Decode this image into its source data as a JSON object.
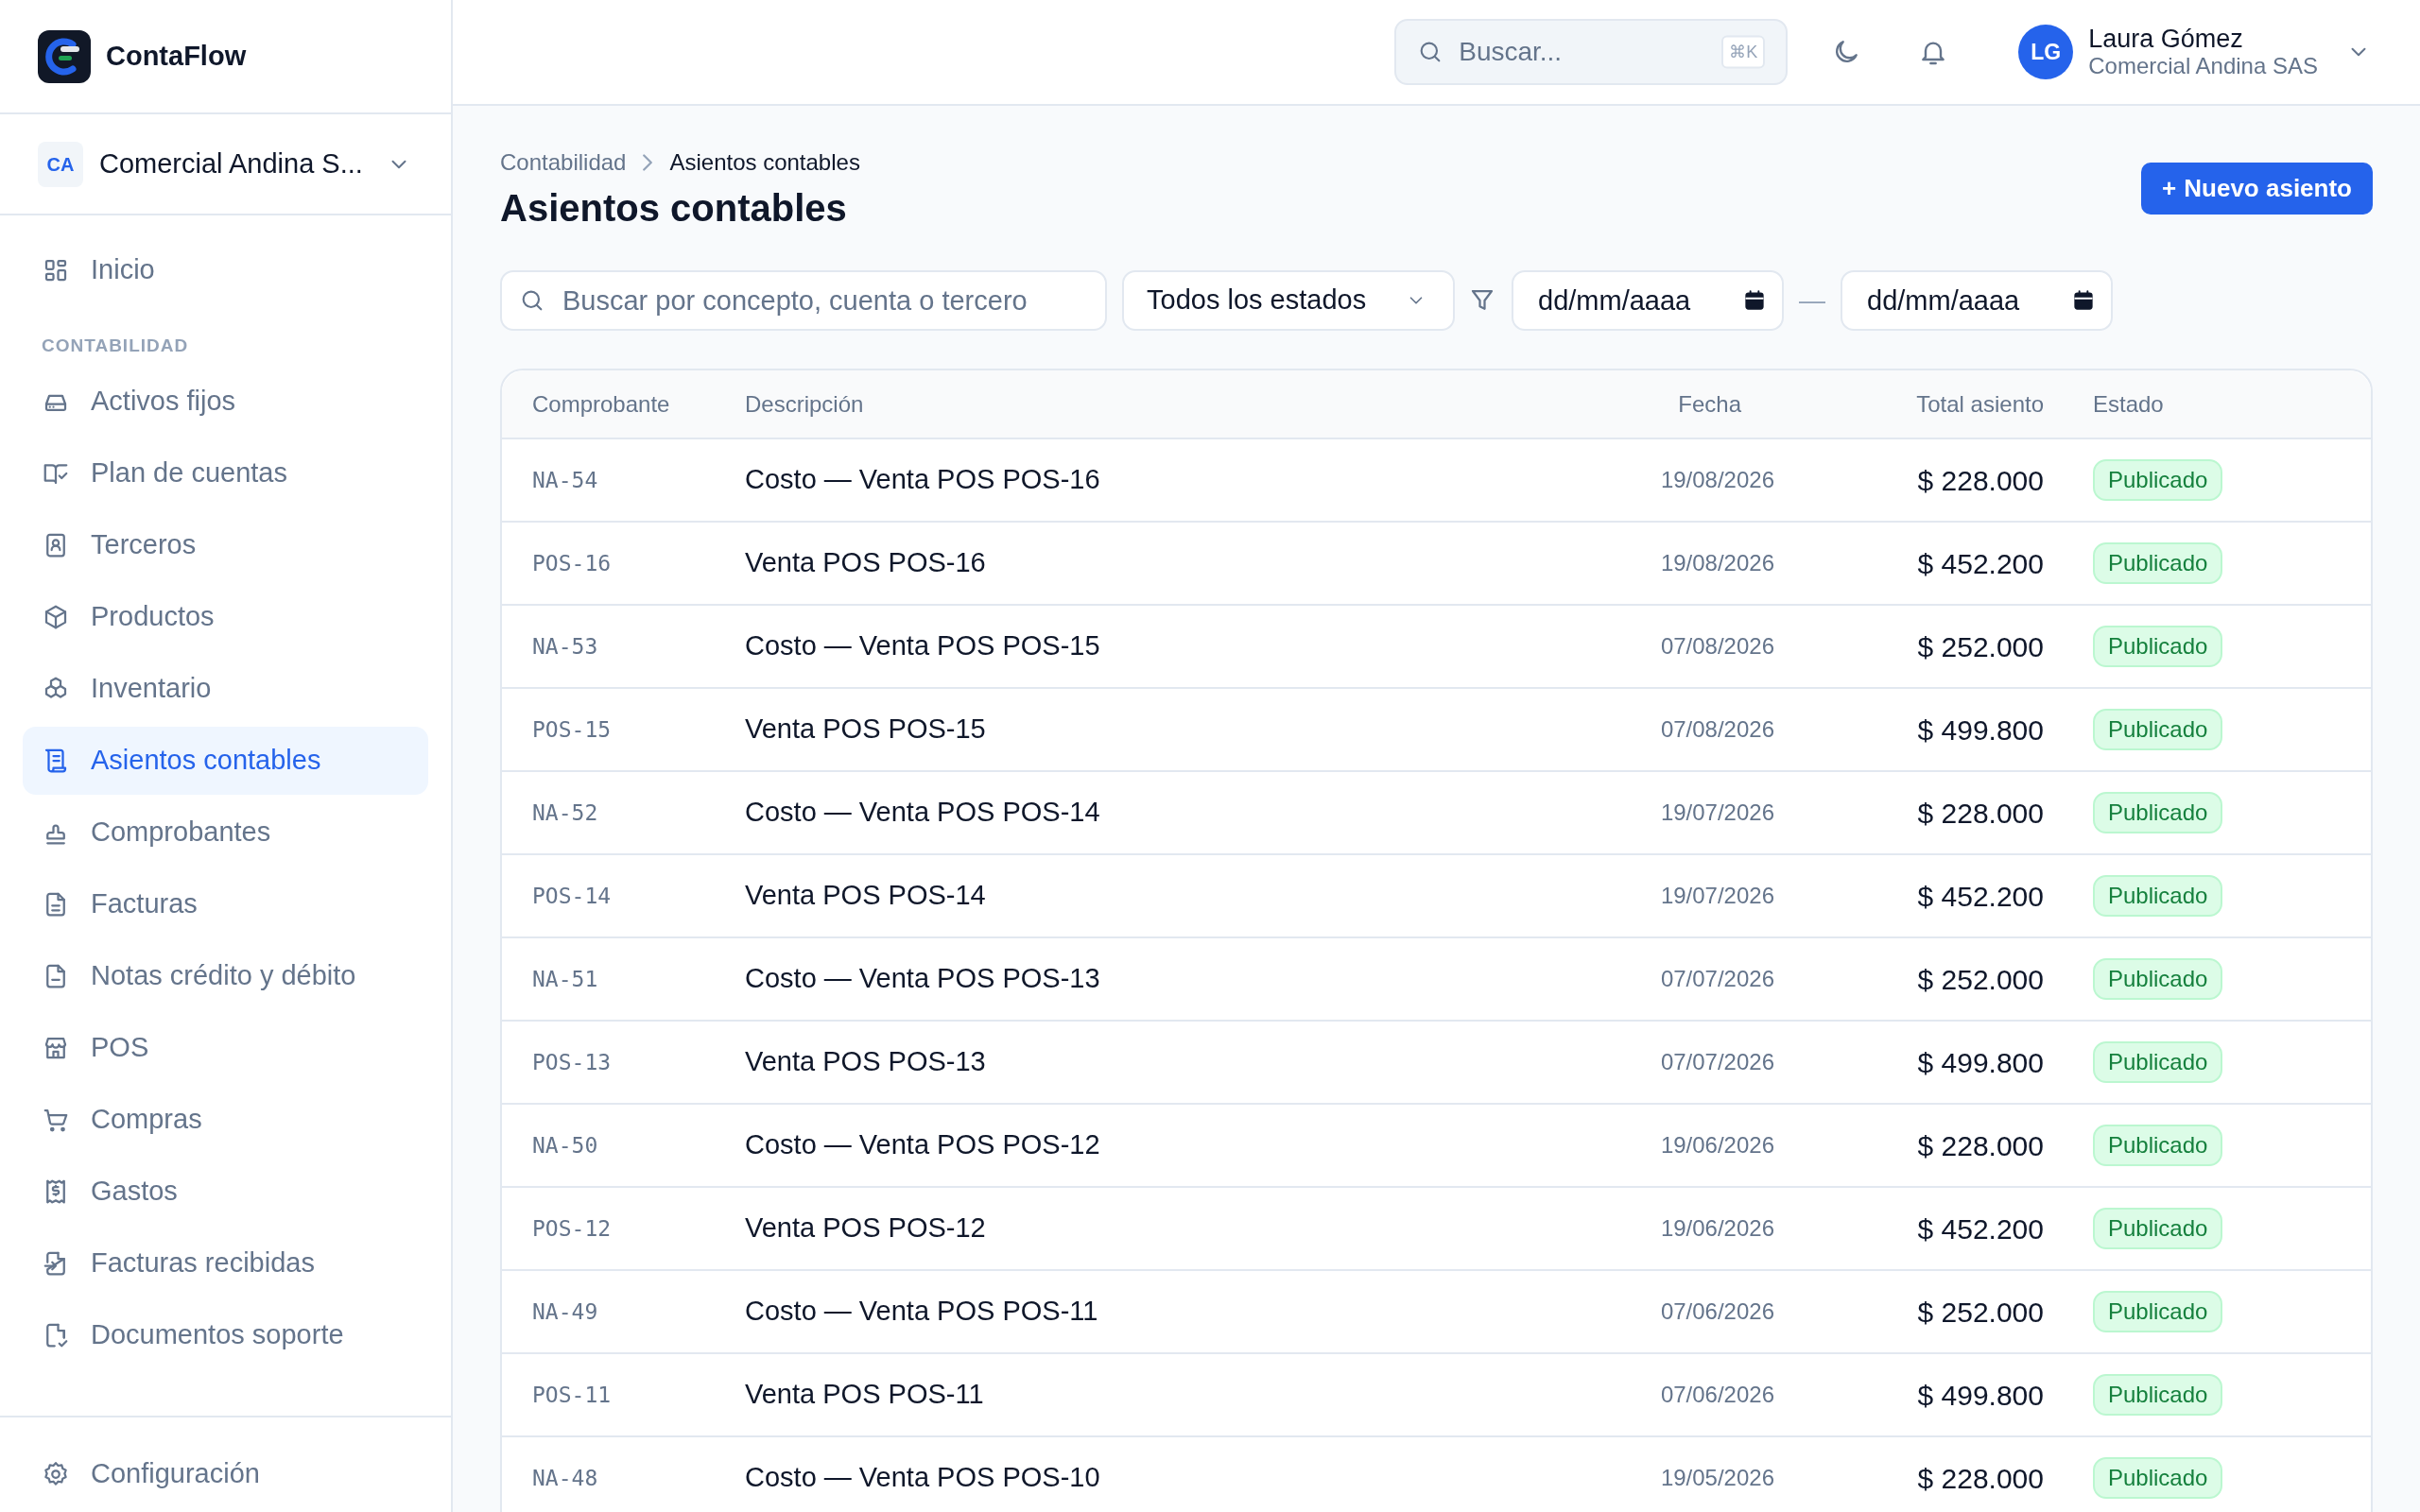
{
  "brand": {
    "name": "ContaFlow"
  },
  "company": {
    "initials": "CA",
    "name": "Comercial Andina S..."
  },
  "nav": [
    {
      "items": [
        {
          "label": "Inicio",
          "selected": false
        }
      ]
    },
    {
      "heading": "CONTABILIDAD",
      "items": [
        {
          "label": "Activos fijos",
          "selected": false
        },
        {
          "label": "Plan de cuentas",
          "selected": false
        },
        {
          "label": "Terceros",
          "selected": false
        },
        {
          "label": "Productos",
          "selected": false
        },
        {
          "label": "Inventario",
          "selected": false
        },
        {
          "label": "Asientos contables",
          "selected": true
        },
        {
          "label": "Comprobantes",
          "selected": false
        },
        {
          "label": "Facturas",
          "selected": false
        },
        {
          "label": "Notas crédito y débito",
          "selected": false
        },
        {
          "label": "POS",
          "selected": false
        },
        {
          "label": "Compras",
          "selected": false
        },
        {
          "label": "Gastos",
          "selected": false
        },
        {
          "label": "Facturas recibidas",
          "selected": false
        },
        {
          "label": "Documentos soporte",
          "selected": false
        }
      ]
    }
  ],
  "nav_footer": {
    "label": "Configuración",
    "selected": false
  },
  "topbar": {
    "search": {
      "placeholder": "Buscar...",
      "shortcut": "⌘K"
    },
    "user": {
      "initials": "LG",
      "name": "Laura Gómez",
      "company": "Comercial Andina SAS"
    }
  },
  "breadcrumb": [
    {
      "label": "Contabilidad",
      "current": false
    },
    {
      "label": "Asientos contables",
      "current": true
    }
  ],
  "title": "Asientos contables",
  "new_button": {
    "icon": "+",
    "label": "Nuevo asiento"
  },
  "filters": {
    "search": {
      "placeholder": "Buscar por concepto, cuenta o tercero"
    },
    "status": "Todos los estados",
    "date_from": {
      "placeholder": "dd/mm/aaaa"
    },
    "separator": "—",
    "date_to": {
      "placeholder": "dd/mm/aaaa"
    }
  },
  "table": {
    "columns": [
      "Comprobante",
      "Descripción",
      "Fecha",
      "Total asiento",
      "Estado"
    ],
    "rows": [
      {
        "voucher": "NA-54",
        "description": "Costo — Venta POS POS-16",
        "date": "19/08/2026",
        "total": "$ 228.000",
        "status": "Publicado"
      },
      {
        "voucher": "POS-16",
        "description": "Venta POS POS-16",
        "date": "19/08/2026",
        "total": "$ 452.200",
        "status": "Publicado"
      },
      {
        "voucher": "NA-53",
        "description": "Costo — Venta POS POS-15",
        "date": "07/08/2026",
        "total": "$ 252.000",
        "status": "Publicado"
      },
      {
        "voucher": "POS-15",
        "description": "Venta POS POS-15",
        "date": "07/08/2026",
        "total": "$ 499.800",
        "status": "Publicado"
      },
      {
        "voucher": "NA-52",
        "description": "Costo — Venta POS POS-14",
        "date": "19/07/2026",
        "total": "$ 228.000",
        "status": "Publicado"
      },
      {
        "voucher": "POS-14",
        "description": "Venta POS POS-14",
        "date": "19/07/2026",
        "total": "$ 452.200",
        "status": "Publicado"
      },
      {
        "voucher": "NA-51",
        "description": "Costo — Venta POS POS-13",
        "date": "07/07/2026",
        "total": "$ 252.000",
        "status": "Publicado"
      },
      {
        "voucher": "POS-13",
        "description": "Venta POS POS-13",
        "date": "07/07/2026",
        "total": "$ 499.800",
        "status": "Publicado"
      },
      {
        "voucher": "NA-50",
        "description": "Costo — Venta POS POS-12",
        "date": "19/06/2026",
        "total": "$ 228.000",
        "status": "Publicado"
      },
      {
        "voucher": "POS-12",
        "description": "Venta POS POS-12",
        "date": "19/06/2026",
        "total": "$ 452.200",
        "status": "Publicado"
      },
      {
        "voucher": "NA-49",
        "description": "Costo — Venta POS POS-11",
        "date": "07/06/2026",
        "total": "$ 252.000",
        "status": "Publicado"
      },
      {
        "voucher": "POS-11",
        "description": "Venta POS POS-11",
        "date": "07/06/2026",
        "total": "$ 499.800",
        "status": "Publicado"
      },
      {
        "voucher": "NA-48",
        "description": "Costo — Venta POS POS-10",
        "date": "19/05/2026",
        "total": "$ 228.000",
        "status": "Publicado"
      }
    ]
  }
}
